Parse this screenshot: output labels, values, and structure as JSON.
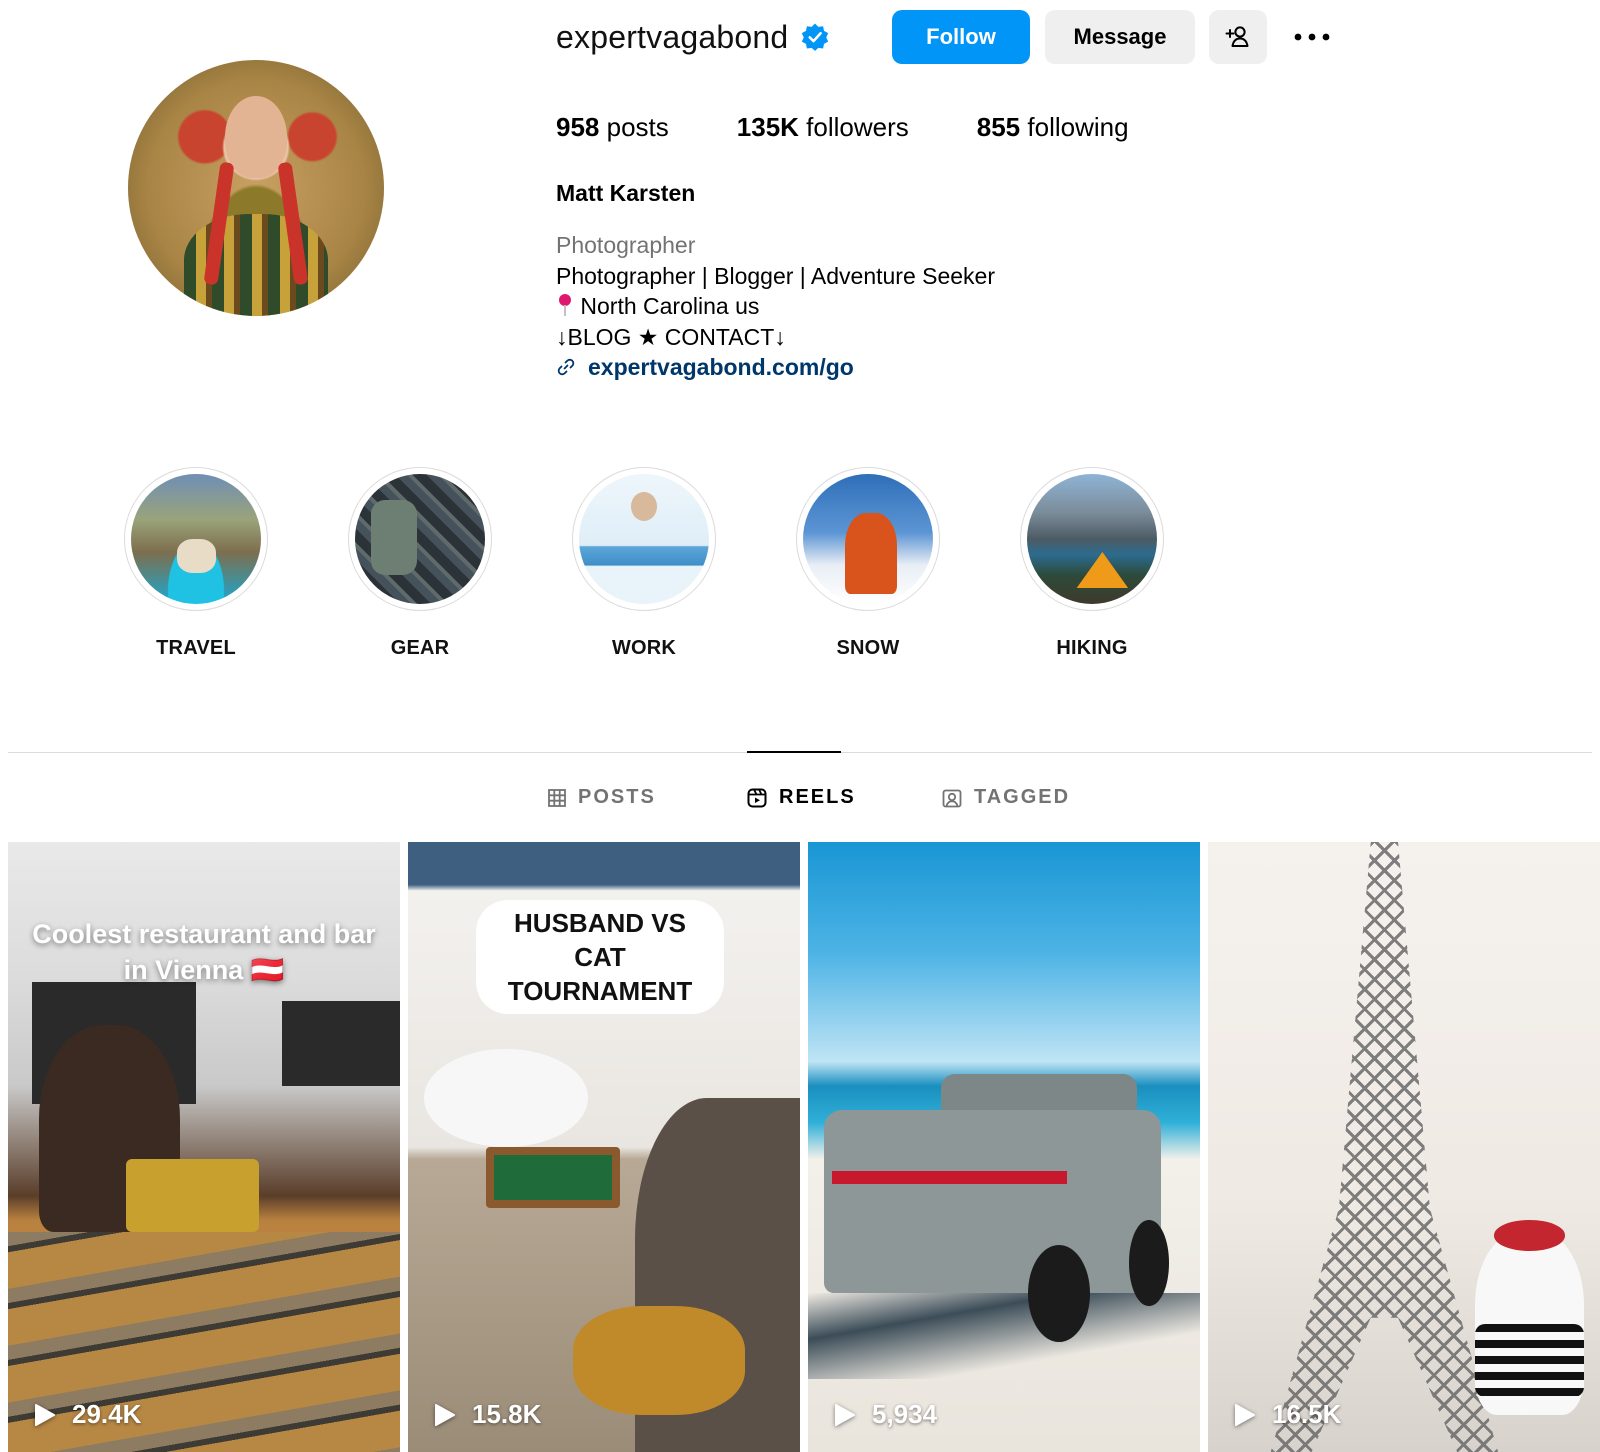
{
  "profile": {
    "username": "expertvagabond",
    "verified": true,
    "follow_label": "Follow",
    "message_label": "Message",
    "add_user_icon": "add-person-icon",
    "more_icon": "more-horizontal-icon",
    "stats": {
      "posts_count": "958",
      "posts_label": "posts",
      "followers_count": "135K",
      "followers_label": "followers",
      "following_count": "855",
      "following_label": "following"
    },
    "full_name": "Matt Karsten",
    "category": "Photographer",
    "bio_line1": "Photographer | Blogger | Adventure Seeker",
    "bio_location": "North Carolina us",
    "bio_line3": "↓BLOG ★ CONTACT↓",
    "link": "expertvagabond.com/go"
  },
  "highlights": [
    {
      "label": "TRAVEL"
    },
    {
      "label": "GEAR"
    },
    {
      "label": "WORK"
    },
    {
      "label": "SNOW"
    },
    {
      "label": "HIKING"
    }
  ],
  "tabs": {
    "posts": "POSTS",
    "reels": "REELS",
    "tagged": "TAGGED",
    "active": "REELS"
  },
  "reels": [
    {
      "caption": "Coolest restaurant and bar in Vienna 🇦🇹",
      "views": "29.4K"
    },
    {
      "caption": "HUSBAND VS CAT TOURNAMENT",
      "views": "15.8K"
    },
    {
      "caption": "",
      "views": "5,934"
    },
    {
      "caption": "",
      "views": "16.5K"
    }
  ],
  "colors": {
    "accent": "#0095f6",
    "secondary_button": "#efefef",
    "muted_text": "#737373",
    "link_text": "#00376b",
    "divider": "#dbdbdb",
    "verified_badge": "#0095f6",
    "location_pin": "#e0176e"
  }
}
